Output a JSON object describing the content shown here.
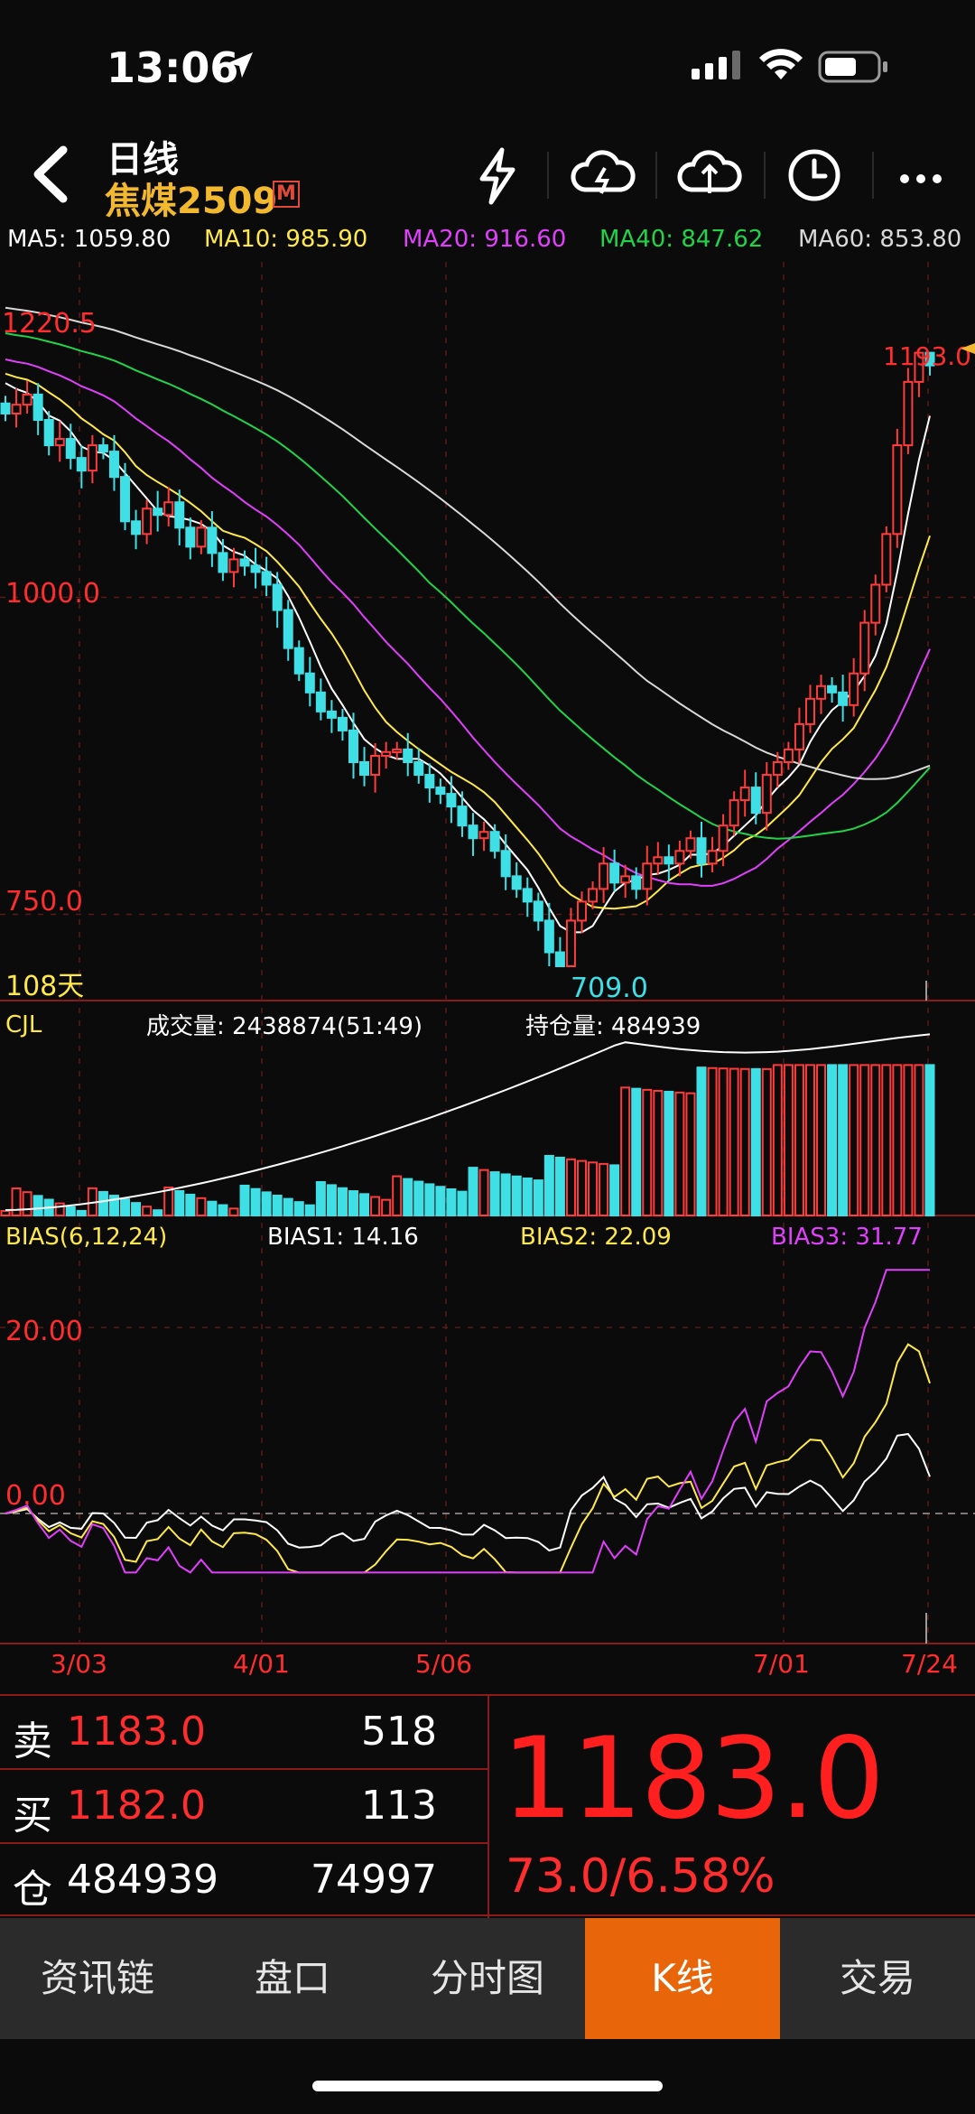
{
  "status": {
    "time": "13:06"
  },
  "header": {
    "title": "日线",
    "symbol": "焦煤2509",
    "badge": "M"
  },
  "header_icons": [
    "lightning-icon",
    "cloud-download-icon",
    "cloud-upload-icon",
    "clock-icon",
    "more-icon"
  ],
  "ma": [
    {
      "label": "MA5: 1059.80",
      "color": "#ffffff"
    },
    {
      "label": "MA10: 985.90",
      "color": "#ffe94a"
    },
    {
      "label": "MA20: 916.60",
      "color": "#e040fb"
    },
    {
      "label": "MA40: 847.62",
      "color": "#22d34a"
    },
    {
      "label": "MA60: 853.80",
      "color": "#d8d8d8"
    }
  ],
  "price_axis": {
    "ticks": [
      "1220.5",
      "1000.0",
      "750.0"
    ],
    "high_label": "1193.0",
    "low_label": "709.0",
    "days_label": "108天"
  },
  "volume": {
    "title": "CJL",
    "volume_label": "成交量: 2438874(51:49)",
    "oi_label": "持仓量: 484939"
  },
  "bias": {
    "title": "BIAS(6,12,24)",
    "b1": "BIAS1: 14.16",
    "b2": "BIAS2: 22.09",
    "b3": "BIAS3: 31.77",
    "ticks": [
      "20.00",
      "0.00"
    ]
  },
  "dates": [
    "3/03",
    "4/01",
    "5/06",
    "7/01",
    "7/24"
  ],
  "chart_data": {
    "type": "candlestick",
    "price_ylim": [
      709,
      1220.5
    ],
    "high": 1193.0,
    "low": 709.0,
    "close_approx": [
      1145,
      1152,
      1160,
      1140,
      1120,
      1125,
      1110,
      1100,
      1120,
      1115,
      1095,
      1060,
      1050,
      1070,
      1065,
      1075,
      1055,
      1040,
      1055,
      1035,
      1020,
      1030,
      1025,
      1020,
      1010,
      990,
      960,
      940,
      925,
      910,
      905,
      895,
      870,
      860,
      875,
      878,
      880,
      870,
      860,
      850,
      845,
      835,
      820,
      810,
      815,
      800,
      780,
      770,
      760,
      745,
      720,
      709,
      745,
      760,
      770,
      790,
      775,
      780,
      770,
      790,
      795,
      790,
      800,
      810,
      790,
      800,
      820,
      840,
      850,
      830,
      860,
      870,
      880,
      900,
      920,
      930,
      925,
      915,
      940,
      980,
      1010,
      1050,
      1120,
      1170,
      1193,
      1183
    ],
    "ma_lines": [
      "MA5",
      "MA10",
      "MA20",
      "MA40",
      "MA60"
    ],
    "bias_ylim": [
      -10,
      35
    ]
  },
  "quote": {
    "sell_label": "卖",
    "sell_price": "1183.0",
    "sell_vol": "518",
    "buy_label": "买",
    "buy_price": "1182.0",
    "buy_vol": "113",
    "oi_label": "仓",
    "oi_value": "484939",
    "oi_change": "74997",
    "last": "1183.0",
    "change": "73.0/6.58%"
  },
  "tabs": [
    {
      "label": "资讯链",
      "active": false
    },
    {
      "label": "盘口",
      "active": false
    },
    {
      "label": "分时图",
      "active": false
    },
    {
      "label": "K线",
      "active": true
    },
    {
      "label": "交易",
      "active": false
    }
  ]
}
